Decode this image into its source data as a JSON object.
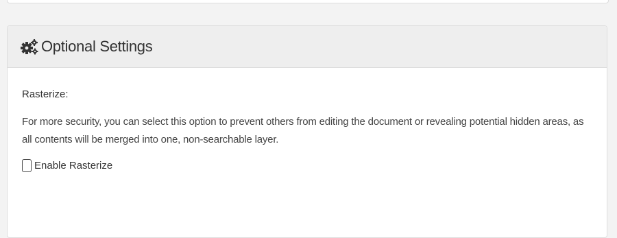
{
  "panel": {
    "title": "Optional Settings",
    "icon": "gears-icon"
  },
  "rasterize": {
    "label": "Rasterize:",
    "description": "For more security, you can select this option to prevent others from editing the document or revealing potential hidden areas, as all contents will be merged into one, non-searchable layer.",
    "checkbox_label": "Enable Rasterize",
    "checked": false
  }
}
